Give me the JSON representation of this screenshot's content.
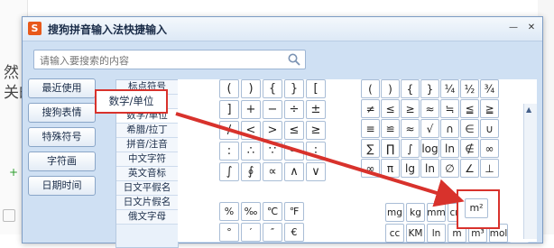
{
  "background": {
    "lines": [
      "然",
      "关的"
    ]
  },
  "window": {
    "logo_letter": "S",
    "title": "搜狗拼音输入法快捷输入",
    "minimize_label": "—",
    "close_label": "✕"
  },
  "search": {
    "placeholder": "请输入要搜索的内容"
  },
  "left_buttons": [
    "最近使用",
    "搜狗表情",
    "特殊符号",
    "字符画",
    "日期时间"
  ],
  "categories": [
    "标点符号",
    "数字序号",
    "数学/单位",
    "希腊/拉丁",
    "拼音/注音",
    "中文字符",
    "英文音标",
    "日文平假名",
    "日文片假名",
    "俄文字母"
  ],
  "highlighted_category": "数学/单位",
  "symbols_basic": [
    "(",
    ")",
    "{",
    "}",
    "[",
    "]",
    "+",
    "−",
    "÷",
    "±",
    "/",
    "<",
    ">",
    "≤",
    "≥",
    ":",
    "∴",
    "∵",
    "∽",
    "∶",
    "∫",
    "∮",
    "∝",
    "∧",
    "∨"
  ],
  "symbols_math": [
    "(",
    ")",
    "{",
    "}",
    "¼",
    "½",
    "¾",
    "≠",
    "≤",
    "≥",
    "≈",
    "≒",
    "≦",
    "≧",
    "≡",
    "≌",
    "≈",
    "√",
    "∩",
    "∈",
    "∪",
    "∑",
    "∏",
    "∫",
    "log",
    "ln",
    "∉",
    "∞",
    "∞",
    "π",
    "lg",
    "ln",
    "∅",
    "∠",
    "⊥"
  ],
  "symbols_misc": [
    "%",
    "‰",
    "℃",
    "℉",
    "°",
    "′",
    "″",
    "€"
  ],
  "symbols_units": [
    "mg",
    "kg",
    "mm",
    "cm",
    "km",
    "㎡",
    "",
    "cc",
    "KM",
    "ln",
    "m",
    "m³",
    "mol",
    ""
  ],
  "highlighted_symbol": "m²",
  "colors": {
    "accent_red": "#d8322c",
    "window_blue": "#cfe0f3"
  }
}
